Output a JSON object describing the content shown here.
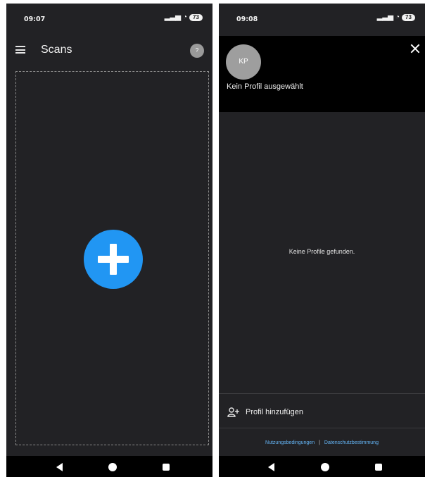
{
  "left_screen": {
    "status": {
      "time": "09:07",
      "battery": "73"
    },
    "app_bar": {
      "title": "Scans",
      "help_symbol": "?",
      "menu_icon": "hamburger-menu-icon"
    },
    "add_scan_button": {
      "icon": "plus-icon",
      "color": "#2196f3"
    }
  },
  "right_screen": {
    "status": {
      "time": "09:08",
      "battery": "73"
    },
    "drawer": {
      "avatar_initials": "KP",
      "profile_status": "Kein Profil ausgewählt",
      "close_icon": "close-icon"
    },
    "empty_message": "Keine Profile gefunden.",
    "add_profile": {
      "label": "Profil hinzufügen",
      "icon": "add-person-icon"
    },
    "footer": {
      "terms_link": "Nutzungsbedingungen",
      "separator": "|",
      "privacy_link": "Datenschutzbestimmung",
      "link_color": "#64b5f6"
    }
  },
  "colors": {
    "background": "#222225",
    "header": "#000000",
    "accent": "#2196f3"
  }
}
